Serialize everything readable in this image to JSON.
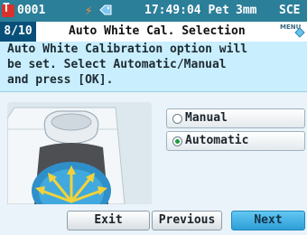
{
  "status_bar": {
    "doc_icon_glyph": "T",
    "sample_number": "0001",
    "time": "17:49:04",
    "day": "Pet",
    "area": "3mm",
    "mode": "SCE",
    "icons": [
      "document-icon",
      "lightning-bolt-icon",
      "tag-icon"
    ],
    "colors": {
      "bar": "#2c7f99",
      "bolt": "#ff8c32",
      "doc_icon": "#d9322b"
    }
  },
  "title_bar": {
    "step": "8/10",
    "title": "Auto White Cal. Selection",
    "menu_icon_label": "MENU"
  },
  "message": {
    "lines": [
      "Auto White Calibration option will",
      "be set. Select Automatic/Manual",
      "and press [OK]."
    ]
  },
  "options": {
    "items": [
      {
        "label": "Manual",
        "selected": false
      },
      {
        "label": "Automatic",
        "selected": true
      }
    ],
    "selected_color": "#1e9a3a"
  },
  "buttons": {
    "exit": "Exit",
    "previous": "Previous",
    "next": "Next",
    "next_color": "#2d9fd8"
  }
}
